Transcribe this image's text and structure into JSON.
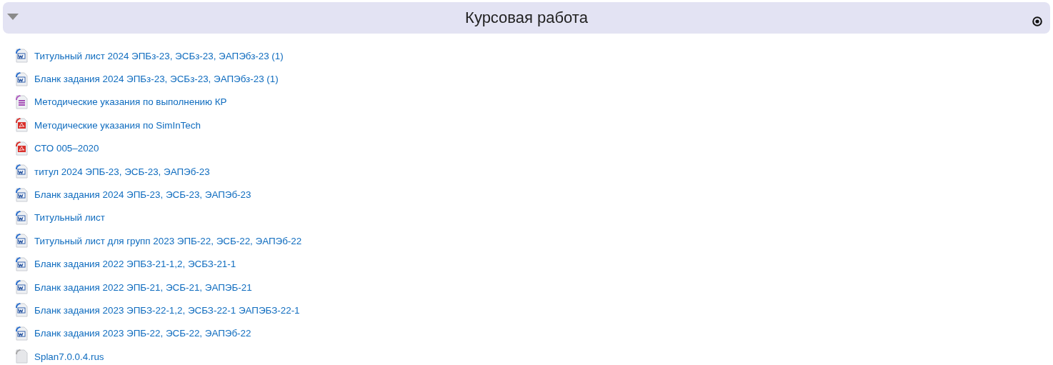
{
  "section": {
    "title": "Курсовая работа",
    "expanded": true
  },
  "files": [
    {
      "name": "Титульный лист 2024 ЭПБз-23, ЭСБз-23, ЭАПЭбз-23 (1)",
      "kind": "word"
    },
    {
      "name": "Бланк задания 2024 ЭПБз-23, ЭСБз-23, ЭАПЭбз-23 (1)",
      "kind": "word"
    },
    {
      "name": "Методические указания по выполнению КР",
      "kind": "document"
    },
    {
      "name": "Методические указания по SimInTech",
      "kind": "pdf"
    },
    {
      "name": "СТО 005–2020",
      "kind": "pdf"
    },
    {
      "name": "титул 2024 ЭПБ-23, ЭСБ-23, ЭАПЭб-23",
      "kind": "word"
    },
    {
      "name": "Бланк задания 2024 ЭПБ-23, ЭСБ-23, ЭАПЭб-23",
      "kind": "word"
    },
    {
      "name": "Титульный лист",
      "kind": "word"
    },
    {
      "name": "Титульный лист для групп 2023 ЭПБ-22, ЭСБ-22, ЭАПЭб-22",
      "kind": "word"
    },
    {
      "name": "Бланк задания 2022 ЭПБЗ-21-1,2, ЭСБЗ-21-1",
      "kind": "word"
    },
    {
      "name": "Бланк задания 2022 ЭПБ-21, ЭСБ-21, ЭАПЭБ-21",
      "kind": "word"
    },
    {
      "name": "Бланк задания 2023 ЭПБЗ-22-1,2, ЭСБЗ-22-1 ЭАПЭБЗ-22-1",
      "kind": "word"
    },
    {
      "name": "Бланк задания 2023 ЭПБ-22, ЭСБ-22, ЭАПЭб-22",
      "kind": "word"
    },
    {
      "name": "Splan7.0.0.4.rus",
      "kind": "file"
    }
  ]
}
